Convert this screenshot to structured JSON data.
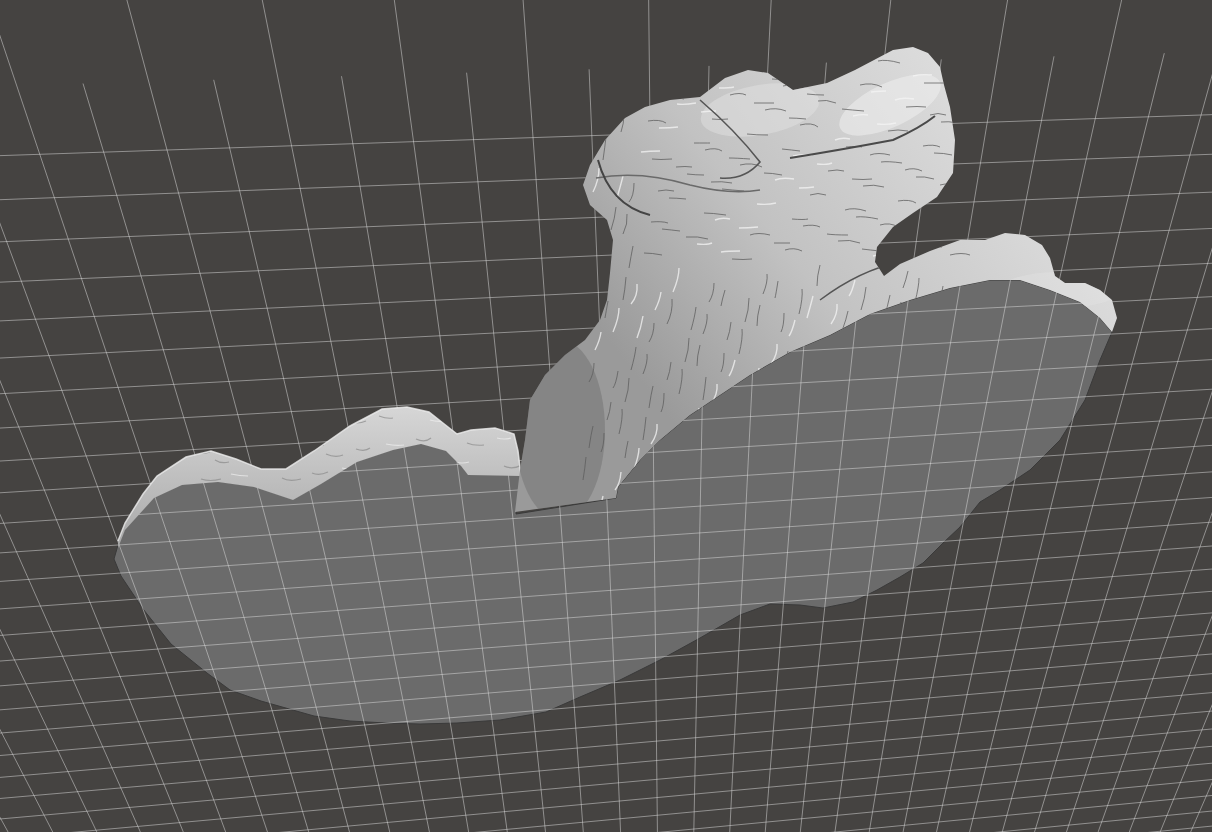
{
  "viewport": {
    "grid": true,
    "model": {
      "kind": "mesh"
    }
  }
}
